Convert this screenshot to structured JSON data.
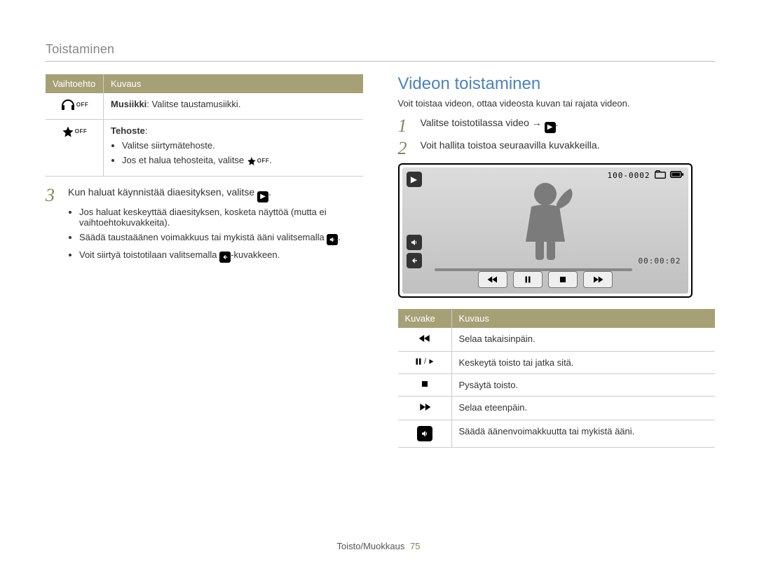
{
  "section_title": "Toistaminen",
  "left": {
    "table": {
      "head": {
        "option": "Vaihtoehto",
        "desc": "Kuvaus"
      },
      "rows": [
        {
          "icon": "headphones-off-icon",
          "main": "Musiikki",
          "main_suffix": ": Valitse taustamusiikki."
        },
        {
          "icon": "star-off-icon",
          "main": "Tehoste",
          "main_suffix": ":",
          "bullets": [
            "Valitse siirtymätehoste.",
            "Jos et halua tehosteita, valitse "
          ]
        }
      ]
    },
    "step3": {
      "num": "3",
      "text_before": "Kun haluat käynnistää diaesityksen, valitse ",
      "text_after": ".",
      "bullets": [
        "Jos haluat keskeyttää diaesityksen, kosketa näyttöä (mutta ei vaihtoehtokuvakkeita).",
        "Säädä taustaäänen voimakkuus tai mykistä ääni valitsemalla ",
        "Voit siirtyä toistotilaan valitsemalla "
      ],
      "bullet2_suffix": ".",
      "bullet3_suffix": "-kuvakkeen."
    }
  },
  "right": {
    "heading": "Videon toistaminen",
    "intro": "Voit toistaa videon, ottaa videosta kuvan tai rajata videon.",
    "step1": {
      "num": "1",
      "text_before": "Valitse toistotilassa video → ",
      "text_after": "."
    },
    "step2": {
      "num": "2",
      "text": "Voit hallita toistoa seuraavilla kuvakkeilla."
    },
    "player": {
      "file_label": "100-0002",
      "time": "00:00:02"
    },
    "icon_table": {
      "head": {
        "icon": "Kuvake",
        "desc": "Kuvaus"
      },
      "rows": [
        {
          "icon": "rewind-icon",
          "text": "Selaa takaisinpäin."
        },
        {
          "icon": "pause-play-icon",
          "text": "Keskeytä toisto tai jatka sitä."
        },
        {
          "icon": "stop-icon",
          "text": "Pysäytä toisto."
        },
        {
          "icon": "forward-icon",
          "text": "Selaa eteenpäin."
        },
        {
          "icon": "volume-icon",
          "text": "Säädä äänenvoimakkuutta tai mykistä ääni."
        }
      ]
    }
  },
  "footer": {
    "label": "Toisto/Muokkaus",
    "page": "75"
  }
}
